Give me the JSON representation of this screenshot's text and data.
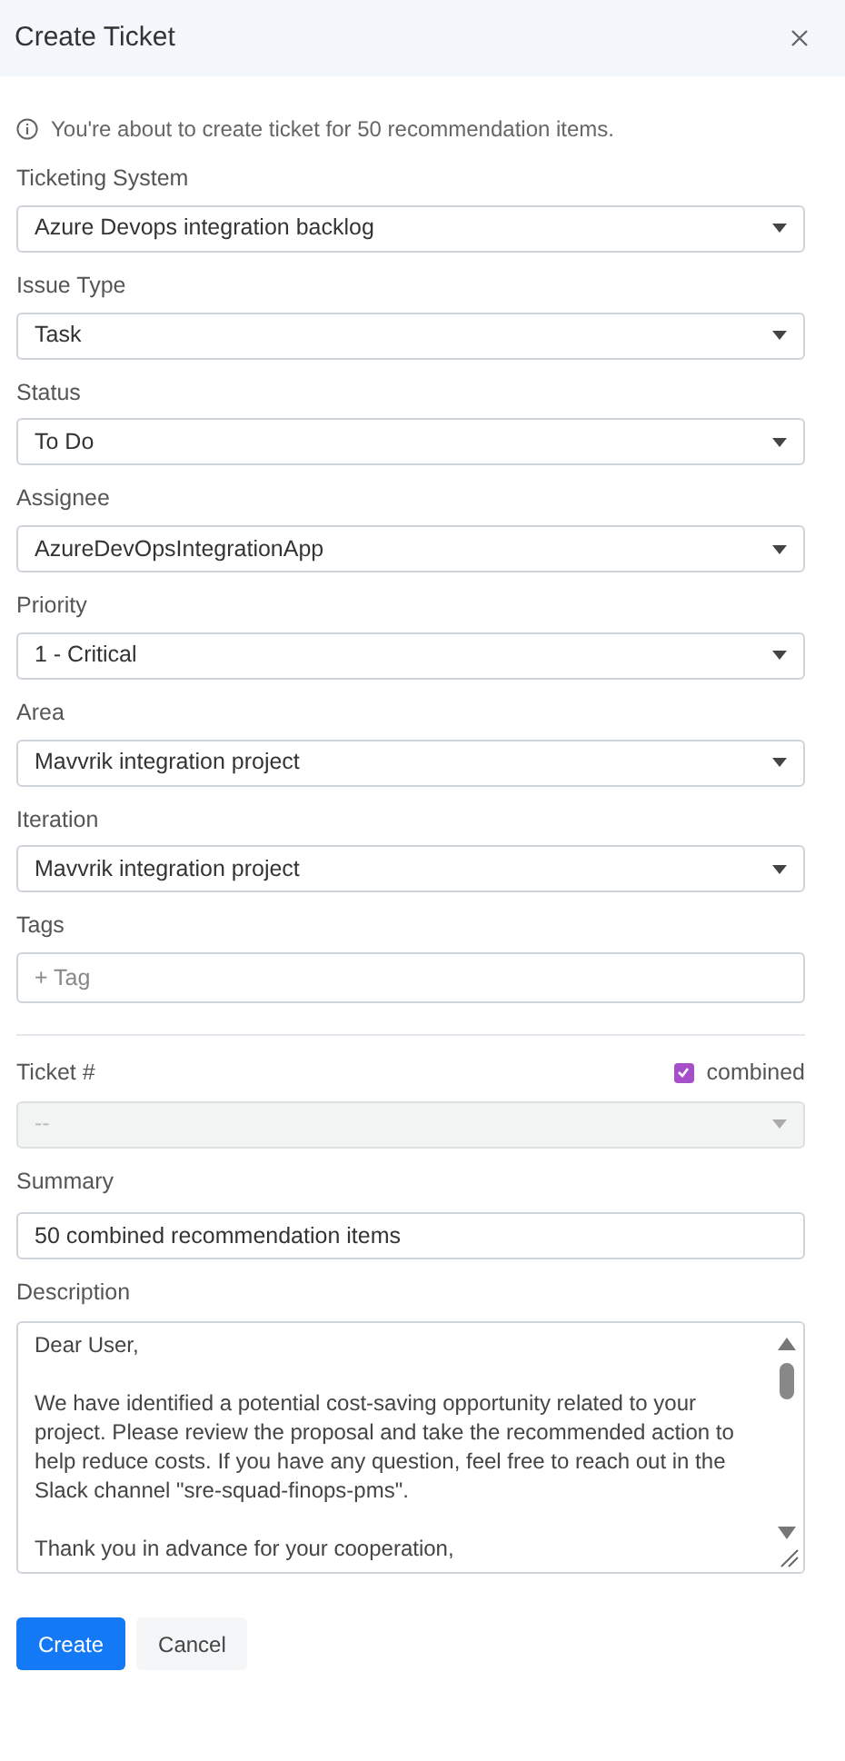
{
  "dialog": {
    "title": "Create Ticket"
  },
  "info": "You're about to create ticket for 50 recommendation items.",
  "fields": [
    {
      "label": "Ticketing System",
      "value": "Azure Devops integration backlog",
      "kind": "select"
    },
    {
      "label": "Issue Type",
      "value": "Task",
      "kind": "select"
    },
    {
      "label": "Status",
      "value": "To Do",
      "kind": "select"
    },
    {
      "label": "Assignee",
      "value": "AzureDevOpsIntegrationApp",
      "kind": "select"
    },
    {
      "label": "Priority",
      "value": "1 - Critical",
      "kind": "select"
    },
    {
      "label": "Area",
      "value": "Mavvrik integration project",
      "kind": "select"
    },
    {
      "label": "Iteration",
      "value": "Mavvrik integration project",
      "kind": "select"
    },
    {
      "label": "Tags",
      "placeholder": "+ Tag",
      "kind": "tags"
    }
  ],
  "ticket": {
    "label": "Ticket #",
    "combined": {
      "label": "combined",
      "checked": true
    },
    "value": "--",
    "disabled": true
  },
  "summary": {
    "label": "Summary",
    "value": "50 combined recommendation items"
  },
  "description": {
    "label": "Description",
    "paragraphs": [
      "Dear User,",
      "We have identified a potential cost-saving opportunity related to your project. Please review the proposal and take the recommended action to help reduce costs. If you have any question, feel free to reach out in the Slack channel \"sre-squad-finops-pms\".",
      "Thank you in advance for your cooperation,"
    ]
  },
  "buttons": [
    {
      "label": "Create",
      "kind": "primary"
    },
    {
      "label": "Cancel",
      "kind": "secondary"
    }
  ]
}
